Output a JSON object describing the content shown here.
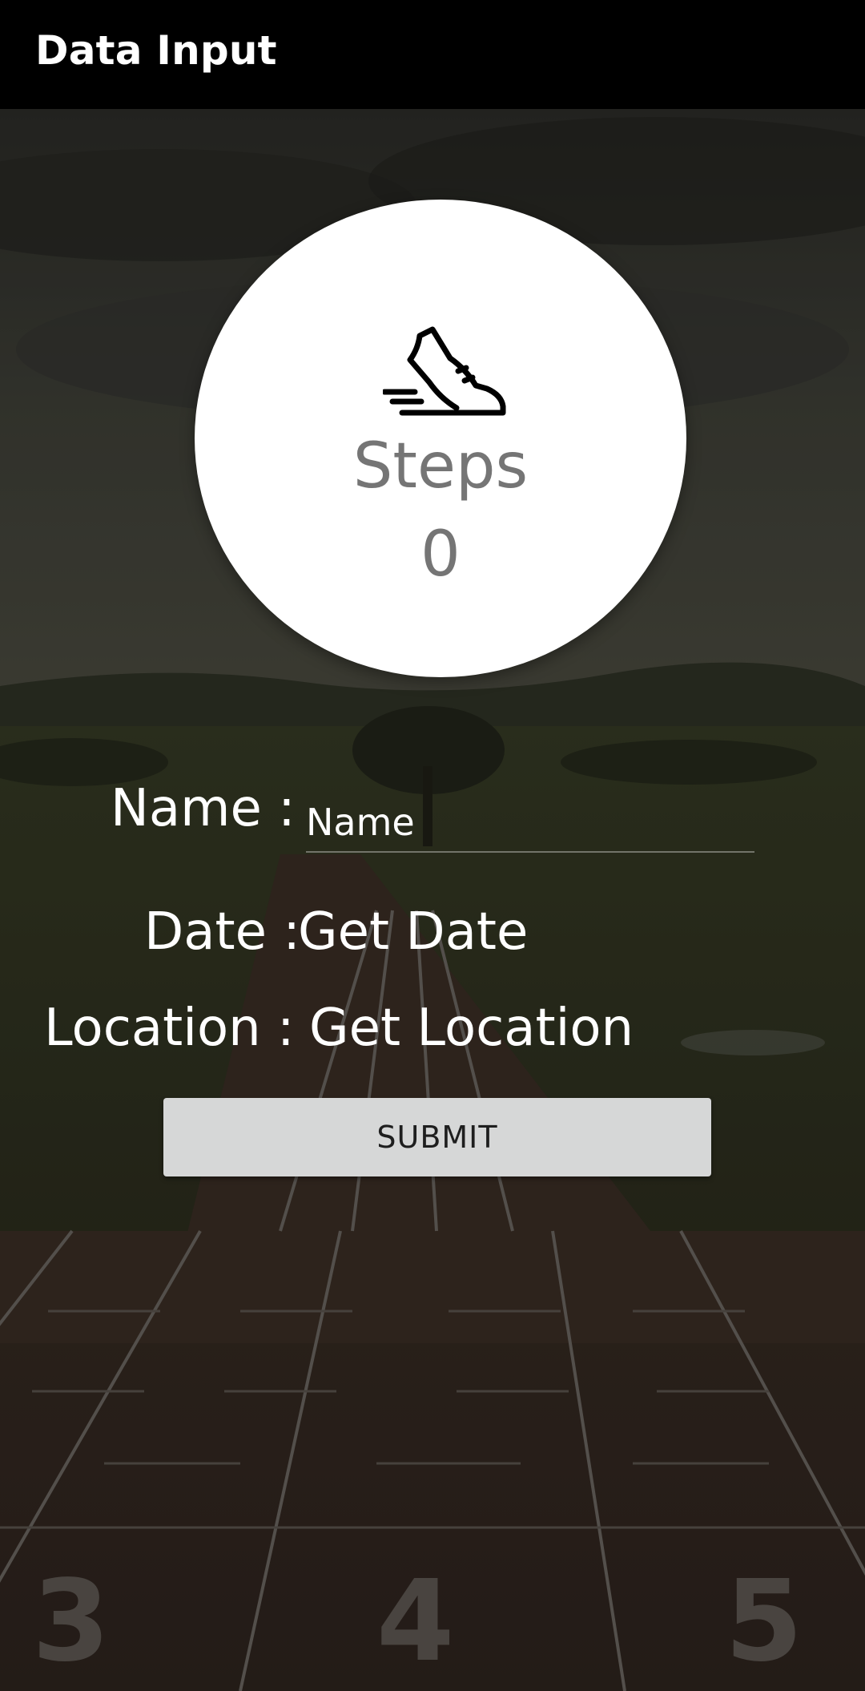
{
  "app_bar": {
    "title": "Data Input"
  },
  "steps_card": {
    "icon": "running-shoe-icon",
    "label": "Steps",
    "value": "0"
  },
  "form": {
    "name_label": "Name :",
    "name_placeholder": "Name",
    "date_label": "Date :",
    "date_value": "Get Date",
    "location_label": "Location :",
    "location_value": "Get Location",
    "submit_label": "SUBMIT"
  },
  "background": {
    "lane_numbers": [
      "3",
      "4",
      "5"
    ]
  },
  "colors": {
    "app_bar": "#000000",
    "circle": "#ffffff",
    "steps_text": "#757575",
    "button": "#d6d7d7",
    "button_text": "#1e1e1e"
  }
}
